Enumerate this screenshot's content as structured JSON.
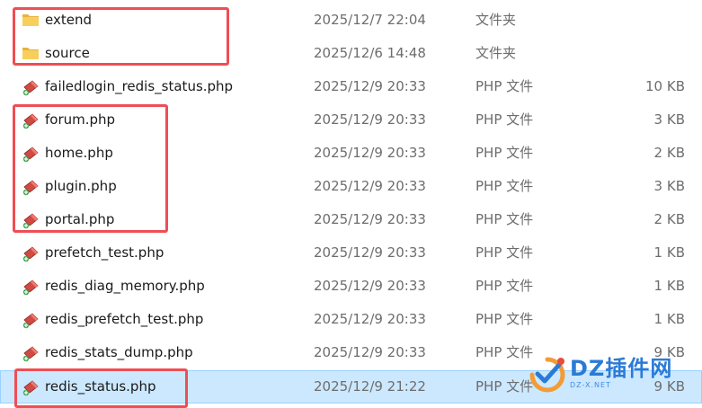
{
  "files": [
    {
      "name": "extend",
      "date": "2025/12/7 22:04",
      "type": "文件夹",
      "size": "",
      "icon": "folder-icon"
    },
    {
      "name": "source",
      "date": "2025/12/6 14:48",
      "type": "文件夹",
      "size": "",
      "icon": "folder-icon"
    },
    {
      "name": "failedlogin_redis_status.php",
      "date": "2025/12/9 20:33",
      "type": "PHP 文件",
      "size": "10 KB",
      "icon": "php-file-icon"
    },
    {
      "name": "forum.php",
      "date": "2025/12/9 20:33",
      "type": "PHP 文件",
      "size": "3 KB",
      "icon": "php-file-icon"
    },
    {
      "name": "home.php",
      "date": "2025/12/9 20:33",
      "type": "PHP 文件",
      "size": "2 KB",
      "icon": "php-file-icon"
    },
    {
      "name": "plugin.php",
      "date": "2025/12/9 20:33",
      "type": "PHP 文件",
      "size": "3 KB",
      "icon": "php-file-icon"
    },
    {
      "name": "portal.php",
      "date": "2025/12/9 20:33",
      "type": "PHP 文件",
      "size": "2 KB",
      "icon": "php-file-icon"
    },
    {
      "name": "prefetch_test.php",
      "date": "2025/12/9 20:33",
      "type": "PHP 文件",
      "size": "1 KB",
      "icon": "php-file-icon"
    },
    {
      "name": "redis_diag_memory.php",
      "date": "2025/12/9 20:33",
      "type": "PHP 文件",
      "size": "1 KB",
      "icon": "php-file-icon"
    },
    {
      "name": "redis_prefetch_test.php",
      "date": "2025/12/9 20:33",
      "type": "PHP 文件",
      "size": "1 KB",
      "icon": "php-file-icon"
    },
    {
      "name": "redis_stats_dump.php",
      "date": "2025/12/9 20:33",
      "type": "PHP 文件",
      "size": "9 KB",
      "icon": "php-file-icon"
    },
    {
      "name": "redis_status.php",
      "date": "2025/12/9 21:22",
      "type": "PHP 文件",
      "size": "9 KB",
      "icon": "php-file-icon",
      "selected": true
    }
  ],
  "colors": {
    "highlight": "#ee4e55",
    "selection": "#cce8ff",
    "folder": "#f8c846",
    "php_icon": "#c0392b"
  },
  "watermark": {
    "brand": "DZ插件网",
    "sub": "DZ-X.NET"
  }
}
